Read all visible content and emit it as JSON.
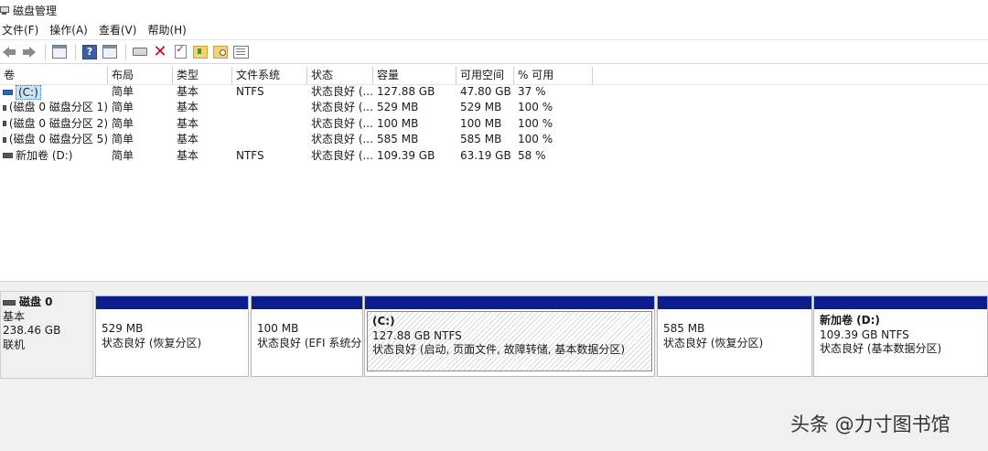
{
  "window": {
    "title": "磁盘管理"
  },
  "menu": [
    "文件(F)",
    "操作(A)",
    "查看(V)",
    "帮助(H)"
  ],
  "toolbar_icons": [
    "back-arrow-icon",
    "forward-arrow-icon",
    "console-tree-icon",
    "help-icon",
    "properties-pane-icon",
    "connect-disk-icon",
    "delete-icon",
    "check-icon",
    "folder-up-icon",
    "folder-search-icon",
    "list-view-icon"
  ],
  "columns": [
    "卷",
    "布局",
    "类型",
    "文件系统",
    "状态",
    "容量",
    "可用空间",
    "% 可用"
  ],
  "volumes": [
    {
      "name": "(C:)",
      "layout": "简单",
      "type": "基本",
      "fs": "NTFS",
      "status": "状态良好 (...",
      "capacity": "127.88 GB",
      "free": "47.80 GB",
      "pct": "37 %"
    },
    {
      "name": "(磁盘 0 磁盘分区 1)",
      "layout": "简单",
      "type": "基本",
      "fs": "",
      "status": "状态良好 (...",
      "capacity": "529 MB",
      "free": "529 MB",
      "pct": "100 %"
    },
    {
      "name": "(磁盘 0 磁盘分区 2)",
      "layout": "简单",
      "type": "基本",
      "fs": "",
      "status": "状态良好 (...",
      "capacity": "100 MB",
      "free": "100 MB",
      "pct": "100 %"
    },
    {
      "name": "(磁盘 0 磁盘分区 5)",
      "layout": "简单",
      "type": "基本",
      "fs": "",
      "status": "状态良好 (...",
      "capacity": "585 MB",
      "free": "585 MB",
      "pct": "100 %"
    },
    {
      "name": "新加卷 (D:)",
      "layout": "简单",
      "type": "基本",
      "fs": "NTFS",
      "status": "状态良好 (...",
      "capacity": "109.39 GB",
      "free": "63.19 GB",
      "pct": "58 %"
    }
  ],
  "disk": {
    "title": "磁盘 0",
    "type": "基本",
    "size": "238.46 GB",
    "state": "联机"
  },
  "partitions": [
    {
      "name": "",
      "size": "529 MB",
      "status": "状态良好 (恢复分区)"
    },
    {
      "name": "",
      "size": "100 MB",
      "status": "状态良好 (EFI 系统分区)"
    },
    {
      "name": "(C:)",
      "size": "127.88 GB NTFS",
      "status": "状态良好 (启动, 页面文件, 故障转储, 基本数据分区)"
    },
    {
      "name": "",
      "size": "585 MB",
      "status": "状态良好 (恢复分区)"
    },
    {
      "name": "新加卷 (D:)",
      "size": "109.39 GB NTFS",
      "status": "状态良好 (基本数据分区)"
    }
  ],
  "watermark": "头条 @力寸图书馆",
  "colors": {
    "partition_bar": "#0c1d8c",
    "selection": "#cce4f7"
  }
}
